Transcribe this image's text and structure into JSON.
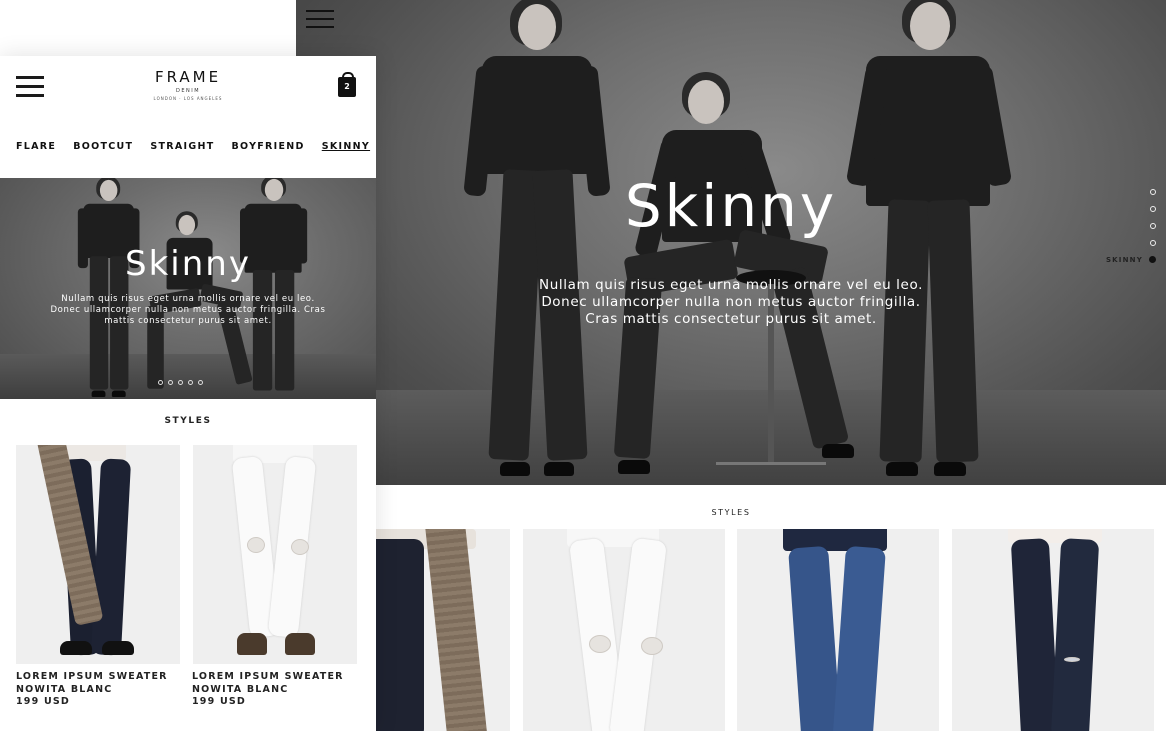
{
  "brand": {
    "name": "FRAME",
    "sub": "DENIM",
    "city": "LONDON · LOS ANGELES"
  },
  "cart": {
    "count": "2"
  },
  "nav": {
    "categories": [
      "FLARE",
      "BOOTCUT",
      "STRAIGHT",
      "BOYFRIEND",
      "SKINNY"
    ],
    "active": "SKINNY"
  },
  "hero": {
    "title": "Skinny",
    "text": "Nullam quis risus eget urna mollis ornare vel eu leo. Donec ullamcorper nulla non metus auctor fringilla. Cras mattis consectetur purus sit amet.",
    "text_lines": [
      "Nullam quis risus eget urna mollis ornare vel eu leo.",
      "Donec ullamcorper nulla non metus auctor fringilla.",
      "Cras mattis consectetur purus sit amet."
    ],
    "mobile_text_lines": [
      "Nullam quis risus eget urna mollis ornare vel eu leo.",
      "Donec ullamcorper nulla non metus auctor fringilla. Cras",
      "mattis consectetur purus sit amet."
    ]
  },
  "section_nav": {
    "dots": 5,
    "active_label": "SKINNY"
  },
  "styles_label": "STYLES",
  "products": [
    {
      "name": "LOREM IPSUM SWEATER",
      "variant": "NOWITA BLANC",
      "price": "199 USD"
    },
    {
      "name": "LOREM IPSUM SWEATER",
      "variant": "NOWITA BLANC",
      "price": "199 USD"
    }
  ],
  "colors": {
    "accent": "#111111",
    "product_bg": "#efefef"
  }
}
